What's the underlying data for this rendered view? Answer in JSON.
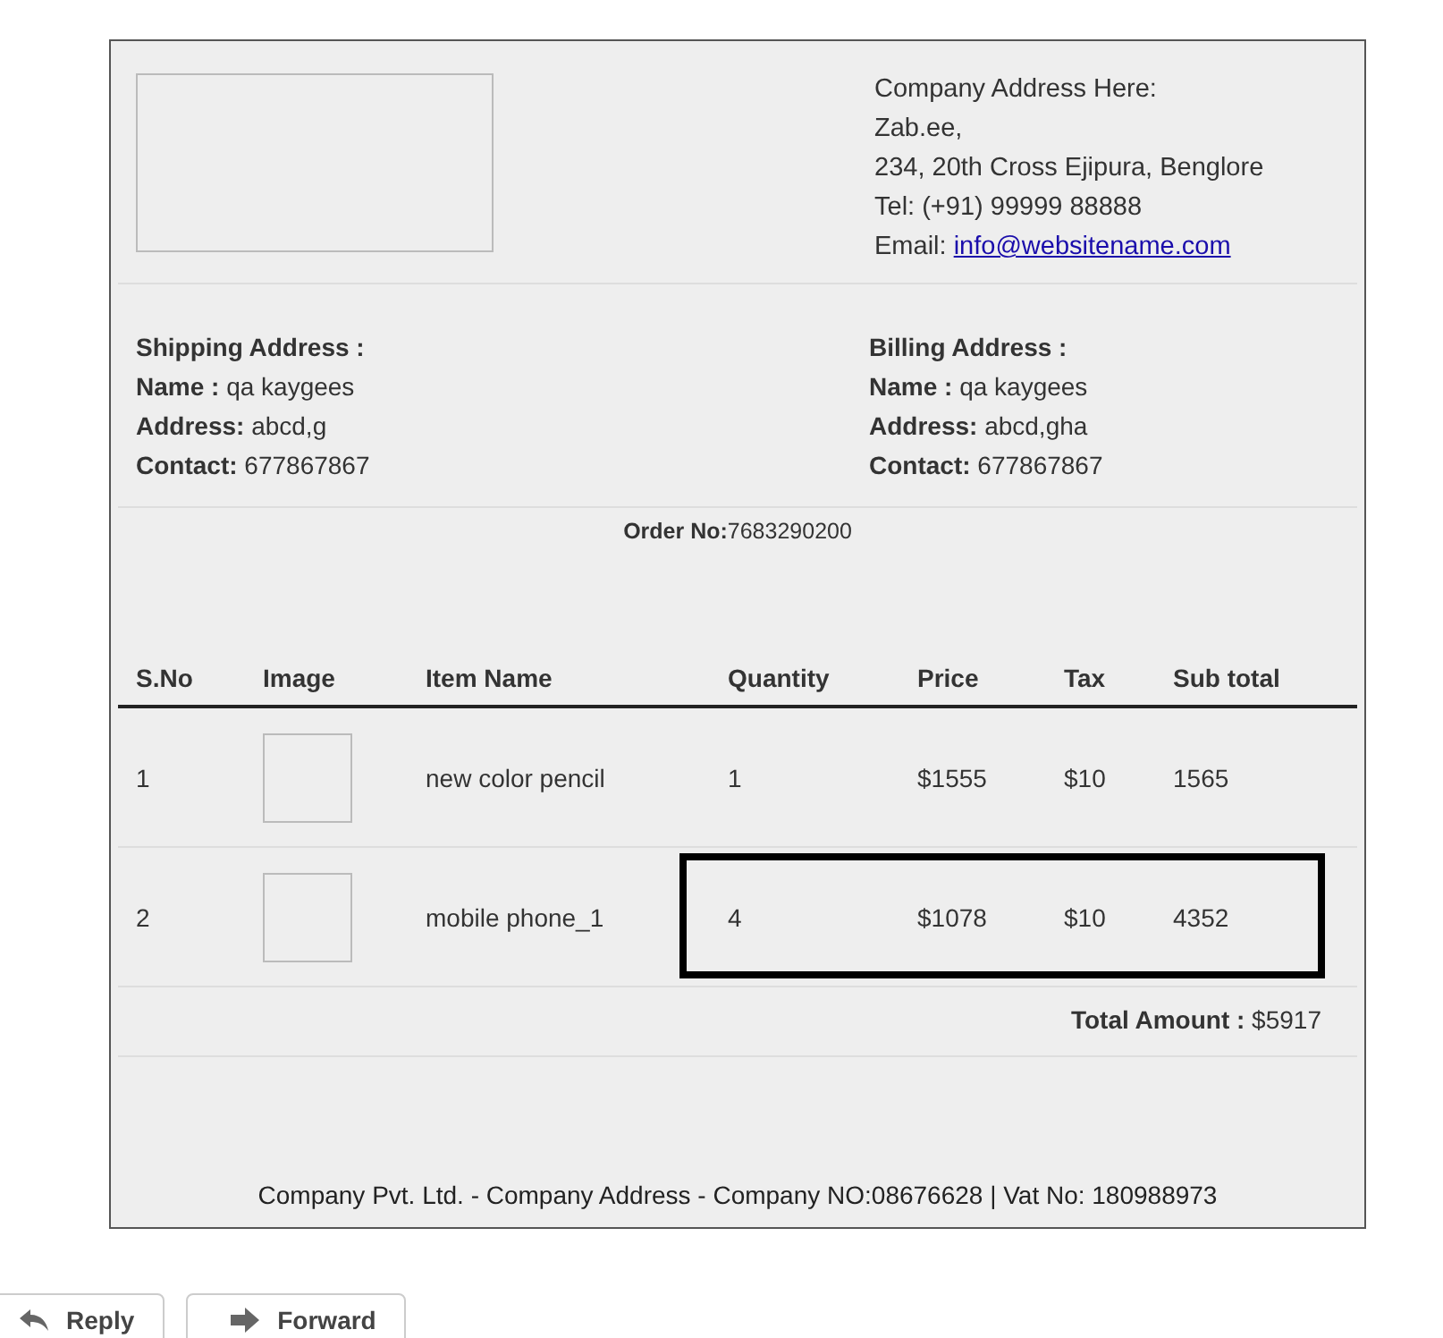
{
  "company": {
    "heading": "Company Address Here:",
    "name": "Zab.ee,",
    "street": "234, 20th Cross Ejipura, Benglore",
    "tel": "Tel: (+91) 99999 88888",
    "email_label": "Email:",
    "email": "info@websitename.com"
  },
  "shipping": {
    "title": "Shipping Address :",
    "fields": [
      {
        "label": "Name :",
        "value": "qa kaygees"
      },
      {
        "label": "Address:",
        "value": "abcd,g"
      },
      {
        "label": "Contact:",
        "value": "677867867"
      }
    ]
  },
  "billing": {
    "title": "Billing Address :",
    "fields": [
      {
        "label": "Name :",
        "value": "qa kaygees"
      },
      {
        "label": "Address:",
        "value": "abcd,gha"
      },
      {
        "label": "Contact:",
        "value": "677867867"
      }
    ]
  },
  "order": {
    "label": "Order No:",
    "number": "7683290200"
  },
  "table": {
    "columns": [
      "S.No",
      "Image",
      "Item Name",
      "Quantity",
      "Price",
      "Tax",
      "Sub total"
    ],
    "rows": [
      {
        "sno": "1",
        "item": "new color pencil",
        "quantity": "1",
        "price": "$1555",
        "tax": "$10",
        "subtotal": "1565",
        "highlighted": false
      },
      {
        "sno": "2",
        "item": "mobile phone_1",
        "quantity": "4",
        "price": "$1078",
        "tax": "$10",
        "subtotal": "4352",
        "highlighted": true
      }
    ]
  },
  "total": {
    "label": "Total Amount :",
    "value": "$5917"
  },
  "footer": "Company Pvt. Ltd. - Company Address - Company NO:08676628 | Vat No: 180988973",
  "actions": [
    "Reply",
    "Forward"
  ]
}
